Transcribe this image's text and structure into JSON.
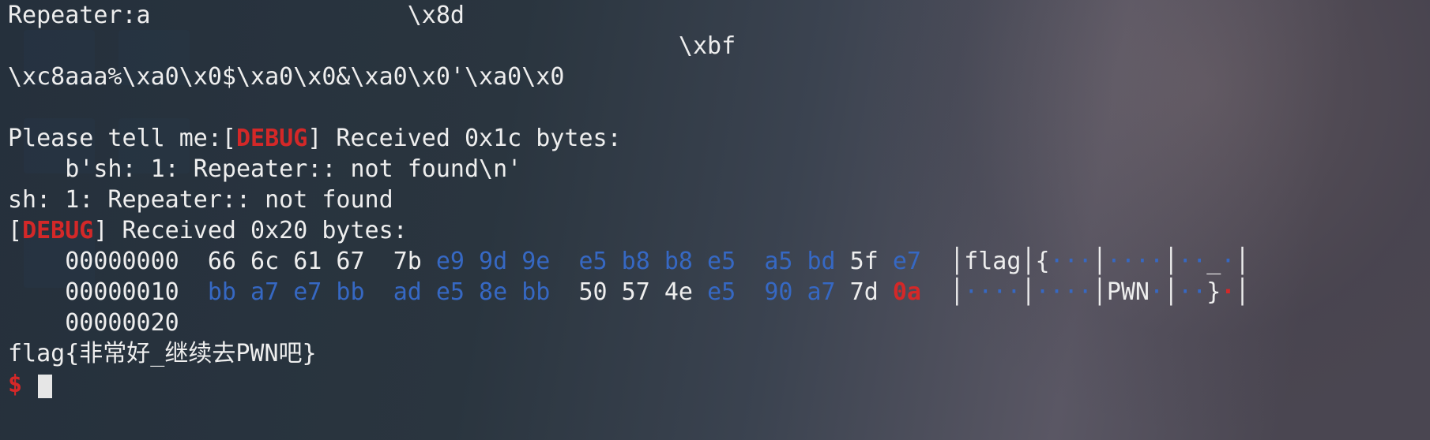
{
  "line1": "Repeater:a                  \\x8d",
  "line2_indent": "                                               ",
  "line2_val": "\\xbf",
  "line3": "\\xc8aaa%\\xa0\\x0$\\xa0\\x0&\\xa0\\x0'\\xa0\\x0",
  "blank": "",
  "line5_a": "Please tell me:[",
  "debug": "DEBUG",
  "line5_b": "] Received 0x1c bytes:",
  "line6": "    b'sh: 1: Repeater:: not found\\n'",
  "line7": "sh: 1: Repeater:: not found",
  "line8_a": "[",
  "line8_b": "] Received 0x20 bytes:",
  "hex_rows": [
    {
      "addr": "    00000000  ",
      "groups": [
        {
          "t": "66 6c 61 67",
          "c": "hl-white"
        },
        {
          "t": "  ",
          "c": ""
        },
        {
          "t": "7b ",
          "c": "hl-white"
        },
        {
          "t": "e9 9d 9e",
          "c": "hl-blue"
        },
        {
          "t": "  ",
          "c": ""
        },
        {
          "t": "e5 b8 b8 e5",
          "c": "hl-blue"
        },
        {
          "t": "  ",
          "c": ""
        },
        {
          "t": "a5 bd",
          "c": "hl-blue"
        },
        {
          "t": " 5f ",
          "c": "hl-white"
        },
        {
          "t": "e7",
          "c": "hl-blue"
        }
      ],
      "ascii": [
        {
          "t": "  │",
          "c": "hl-white"
        },
        {
          "t": "flag",
          "c": "hl-white"
        },
        {
          "t": "│",
          "c": "hl-white"
        },
        {
          "t": "{",
          "c": "hl-white"
        },
        {
          "t": "···",
          "c": "hl-blue"
        },
        {
          "t": "│",
          "c": "hl-white"
        },
        {
          "t": "····",
          "c": "hl-blue"
        },
        {
          "t": "│",
          "c": "hl-white"
        },
        {
          "t": "··",
          "c": "hl-blue"
        },
        {
          "t": "_",
          "c": "hl-white"
        },
        {
          "t": "·",
          "c": "hl-blue"
        },
        {
          "t": "│",
          "c": "hl-white"
        }
      ]
    },
    {
      "addr": "    00000010  ",
      "groups": [
        {
          "t": "bb a7 e7 bb",
          "c": "hl-blue"
        },
        {
          "t": "  ",
          "c": ""
        },
        {
          "t": "ad e5 8e bb",
          "c": "hl-blue"
        },
        {
          "t": "  ",
          "c": ""
        },
        {
          "t": "50 57 4e ",
          "c": "hl-white"
        },
        {
          "t": "e5",
          "c": "hl-blue"
        },
        {
          "t": "  ",
          "c": ""
        },
        {
          "t": "90 a7",
          "c": "hl-blue"
        },
        {
          "t": " 7d ",
          "c": "hl-white"
        },
        {
          "t": "0a",
          "c": "hl-red"
        }
      ],
      "ascii": [
        {
          "t": "  │",
          "c": "hl-white"
        },
        {
          "t": "····",
          "c": "hl-blue"
        },
        {
          "t": "│",
          "c": "hl-white"
        },
        {
          "t": "····",
          "c": "hl-blue"
        },
        {
          "t": "│",
          "c": "hl-white"
        },
        {
          "t": "PWN",
          "c": "hl-white"
        },
        {
          "t": "·",
          "c": "hl-blue"
        },
        {
          "t": "│",
          "c": "hl-white"
        },
        {
          "t": "··",
          "c": "hl-blue"
        },
        {
          "t": "}",
          "c": "hl-white"
        },
        {
          "t": "·",
          "c": "hl-red"
        },
        {
          "t": "│",
          "c": "hl-white"
        }
      ]
    },
    {
      "addr": "    00000020",
      "groups": [],
      "ascii": []
    }
  ],
  "flag_line": "flag{非常好_继续去PWN吧}",
  "prompt": "$ "
}
